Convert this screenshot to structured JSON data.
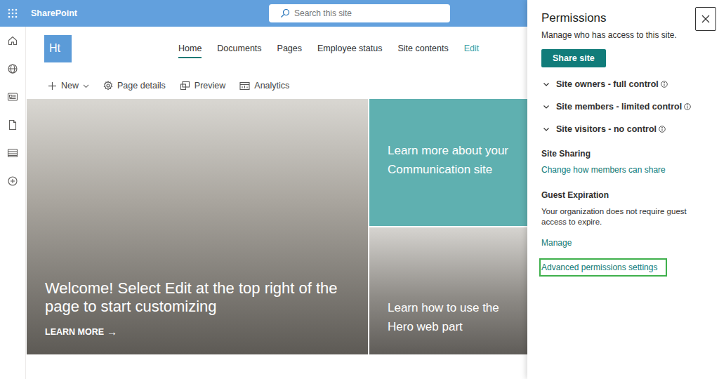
{
  "app": {
    "title": "SharePoint"
  },
  "search": {
    "placeholder": "Search this site"
  },
  "site": {
    "logo": "Ht"
  },
  "nav": [
    {
      "label": "Home",
      "selected": true,
      "kind": "tab"
    },
    {
      "label": "Documents",
      "selected": false,
      "kind": "tab"
    },
    {
      "label": "Pages",
      "selected": false,
      "kind": "tab"
    },
    {
      "label": "Employee status",
      "selected": false,
      "kind": "tab"
    },
    {
      "label": "Site contents",
      "selected": false,
      "kind": "tab"
    },
    {
      "label": "Edit",
      "selected": false,
      "kind": "link"
    }
  ],
  "commands": [
    {
      "label": "New"
    },
    {
      "label": "Page details"
    },
    {
      "label": "Preview"
    },
    {
      "label": "Analytics"
    }
  ],
  "hero": {
    "main": {
      "title": "Welcome! Select Edit at the top right of the page to start customizing",
      "link": "LEARN MORE",
      "arrow": "→"
    },
    "tiles": [
      {
        "title": "Learn more about your Communication site",
        "color": "#5fb0b0"
      },
      {
        "title": "Learn how to use the Hero web part",
        "color": "#8e8b86"
      }
    ]
  },
  "panel": {
    "title": "Permissions",
    "description": "Manage who has access to this site.",
    "share_button": "Share site",
    "groups": [
      {
        "label": "Site owners - full control",
        "expanded": false
      },
      {
        "label": "Site members - limited control",
        "expanded": false
      },
      {
        "label": "Site visitors - no control",
        "expanded": false
      }
    ],
    "sharing": {
      "heading": "Site Sharing",
      "link": "Change how members can share"
    },
    "guest_expiration": {
      "heading": "Guest Expiration",
      "text": "Your organization does not require guest access to expire.",
      "link": "Manage"
    },
    "advanced": {
      "label": "Advanced permissions settings",
      "highlighted": true
    }
  }
}
